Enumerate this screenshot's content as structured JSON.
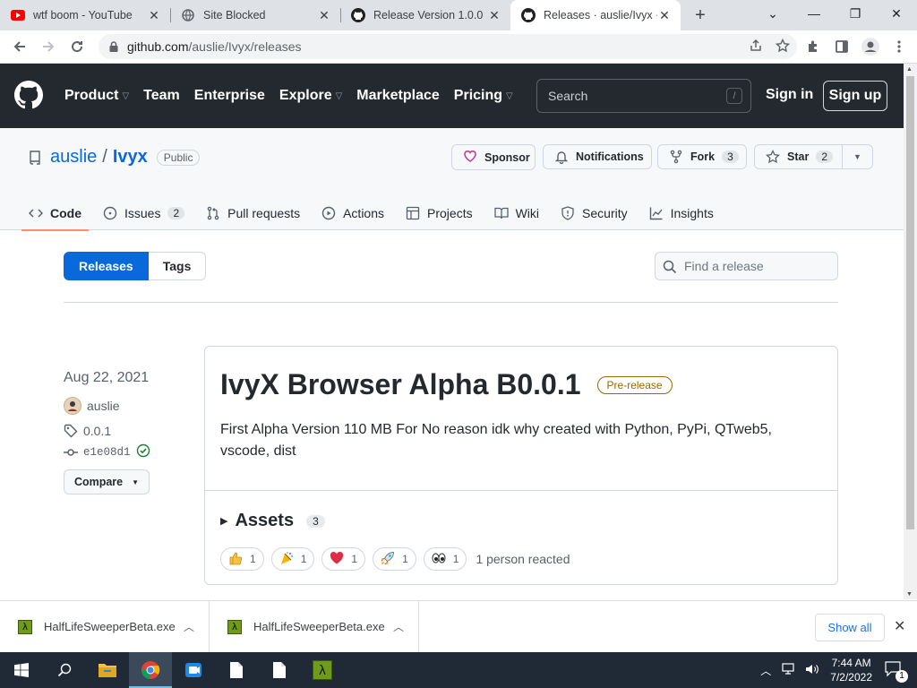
{
  "browser": {
    "tabs": [
      {
        "title": "wtf boom - YouTube",
        "icon": "youtube-icon"
      },
      {
        "title": "Site Blocked",
        "icon": "globe-icon"
      },
      {
        "title": "Release Version 1.0.0 ·",
        "icon": "github-icon"
      },
      {
        "title": "Releases · auslie/Ivyx ·",
        "icon": "github-icon",
        "active": true
      }
    ],
    "url_host": "github.com",
    "url_path": "/auslie/Ivyx/releases"
  },
  "gh_header": {
    "nav": [
      "Product",
      "Team",
      "Enterprise",
      "Explore",
      "Marketplace",
      "Pricing"
    ],
    "search_placeholder": "Search",
    "search_key": "/",
    "sign_in": "Sign in",
    "sign_up": "Sign up"
  },
  "repo": {
    "owner": "auslie",
    "separator": "/",
    "name": "Ivyx",
    "visibility": "Public",
    "sponsor": "Sponsor",
    "notifications": "Notifications",
    "fork_label": "Fork",
    "fork_count": "3",
    "star_label": "Star",
    "star_count": "2",
    "tabs": {
      "code": "Code",
      "issues": "Issues",
      "issues_count": "2",
      "pulls": "Pull requests",
      "actions": "Actions",
      "projects": "Projects",
      "wiki": "Wiki",
      "security": "Security",
      "insights": "Insights"
    }
  },
  "releases_page": {
    "releases_tab": "Releases",
    "tags_tab": "Tags",
    "find_placeholder": "Find a release"
  },
  "release": {
    "date": "Aug 22, 2021",
    "author": "auslie",
    "tag": "0.0.1",
    "commit": "e1e08d1",
    "compare": "Compare",
    "title": "IvyX Browser Alpha B0.0.1",
    "badge": "Pre-release",
    "description": "First Alpha Version 110 MB For No reason idk why created with Python, PyPi, QTweb5, vscode, dist",
    "assets_label": "Assets",
    "assets_count": "3",
    "reactions": [
      {
        "emoji": "👍",
        "count": "1"
      },
      {
        "emoji": "🎉",
        "count": "1"
      },
      {
        "emoji": "❤",
        "count": "1"
      },
      {
        "emoji": "🚀",
        "count": "1"
      },
      {
        "emoji": "👀",
        "count": "1"
      }
    ],
    "reacted_text": "1 person reacted"
  },
  "downloads": {
    "items": [
      "HalfLifeSweeperBeta.exe",
      "HalfLifeSweeperBeta.exe"
    ],
    "show_all": "Show all"
  },
  "taskbar": {
    "time": "7:44 AM",
    "date": "7/2/2022",
    "notifications": "1"
  }
}
